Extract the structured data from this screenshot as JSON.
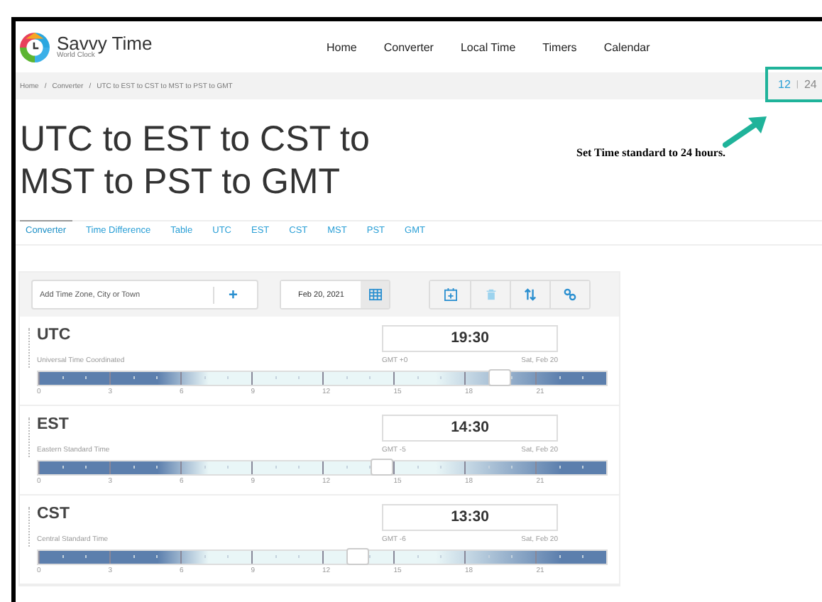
{
  "brand": {
    "name": "Savvy Time",
    "tagline": "World Clock"
  },
  "nav": [
    "Home",
    "Converter",
    "Local Time",
    "Timers",
    "Calendar"
  ],
  "breadcrumb": [
    "Home",
    "/",
    "Converter",
    "/",
    "UTC to EST to CST to MST to PST to GMT"
  ],
  "time_format": {
    "options": [
      {
        "label": "12",
        "selected": true
      },
      {
        "label": "24",
        "selected": false
      }
    ],
    "separator": "|"
  },
  "title": "UTC to EST to CST to MST to PST to GMT",
  "annotation": "Set Time standard to 24 hours.",
  "tabs": [
    {
      "label": "Converter",
      "selected": true
    },
    {
      "label": "Time Difference",
      "selected": false
    },
    {
      "label": "Table",
      "selected": false
    },
    {
      "label": "UTC",
      "selected": false
    },
    {
      "label": "EST",
      "selected": false
    },
    {
      "label": "CST",
      "selected": false
    },
    {
      "label": "MST",
      "selected": false
    },
    {
      "label": "PST",
      "selected": false
    },
    {
      "label": "GMT",
      "selected": false
    }
  ],
  "toolbar": {
    "placeholder": "Add Time Zone, City or Town",
    "add": "+",
    "date": "Feb 20, 2021"
  },
  "zones": [
    {
      "code": "UTC",
      "name": "Universal Time Coordinated",
      "time": "19:30",
      "offset": "GMT +0",
      "date": "Sat, Feb 20",
      "level": 0.8125,
      "ticks": [
        "0",
        "3",
        "6",
        "9",
        "12",
        "15",
        "18",
        "21"
      ]
    },
    {
      "code": "EST",
      "name": "Eastern Standard Time",
      "time": "14:30",
      "offset": "GMT -5",
      "date": "Sat, Feb 20",
      "level": 0.604,
      "ticks": [
        "0",
        "3",
        "6",
        "9",
        "12",
        "15",
        "18",
        "21"
      ]
    },
    {
      "code": "CST",
      "name": "Central Standard Time",
      "time": "13:30",
      "offset": "GMT -6",
      "date": "Sat, Feb 20",
      "level": 0.5625,
      "ticks": [
        "0",
        "3",
        "6",
        "9",
        "12",
        "15",
        "18",
        "21"
      ]
    }
  ]
}
